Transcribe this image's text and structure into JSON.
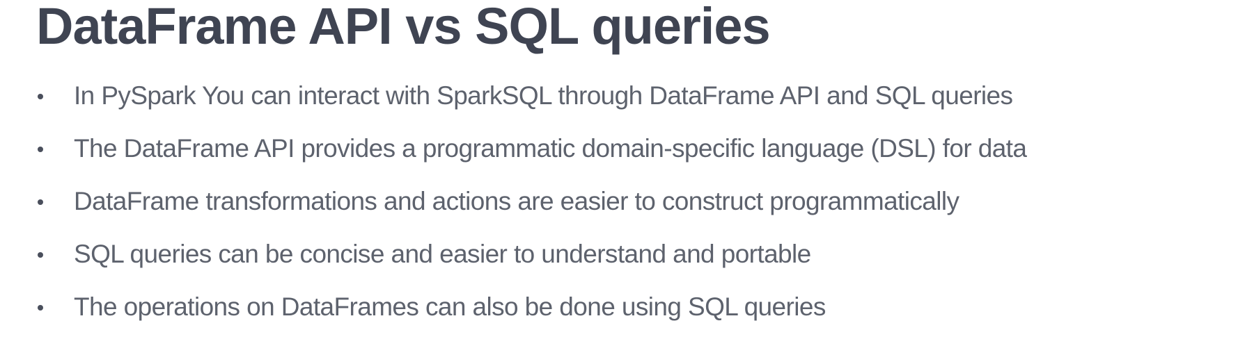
{
  "slide": {
    "title": "DataFrame API vs SQL queries",
    "bullets": [
      "In PySpark You can interact with SparkSQL through DataFrame API and SQL queries",
      "The DataFrame API provides a programmatic domain-specific language (DSL) for data",
      "DataFrame transformations and actions are easier to construct programmatically",
      "SQL queries can be concise and easier to understand and portable",
      "The operations on DataFrames can also be done using SQL queries"
    ]
  },
  "colors": {
    "title": "#3f4452",
    "body_text": "#5d626d",
    "bullet": "#4a4f5c",
    "background": "#ffffff"
  }
}
